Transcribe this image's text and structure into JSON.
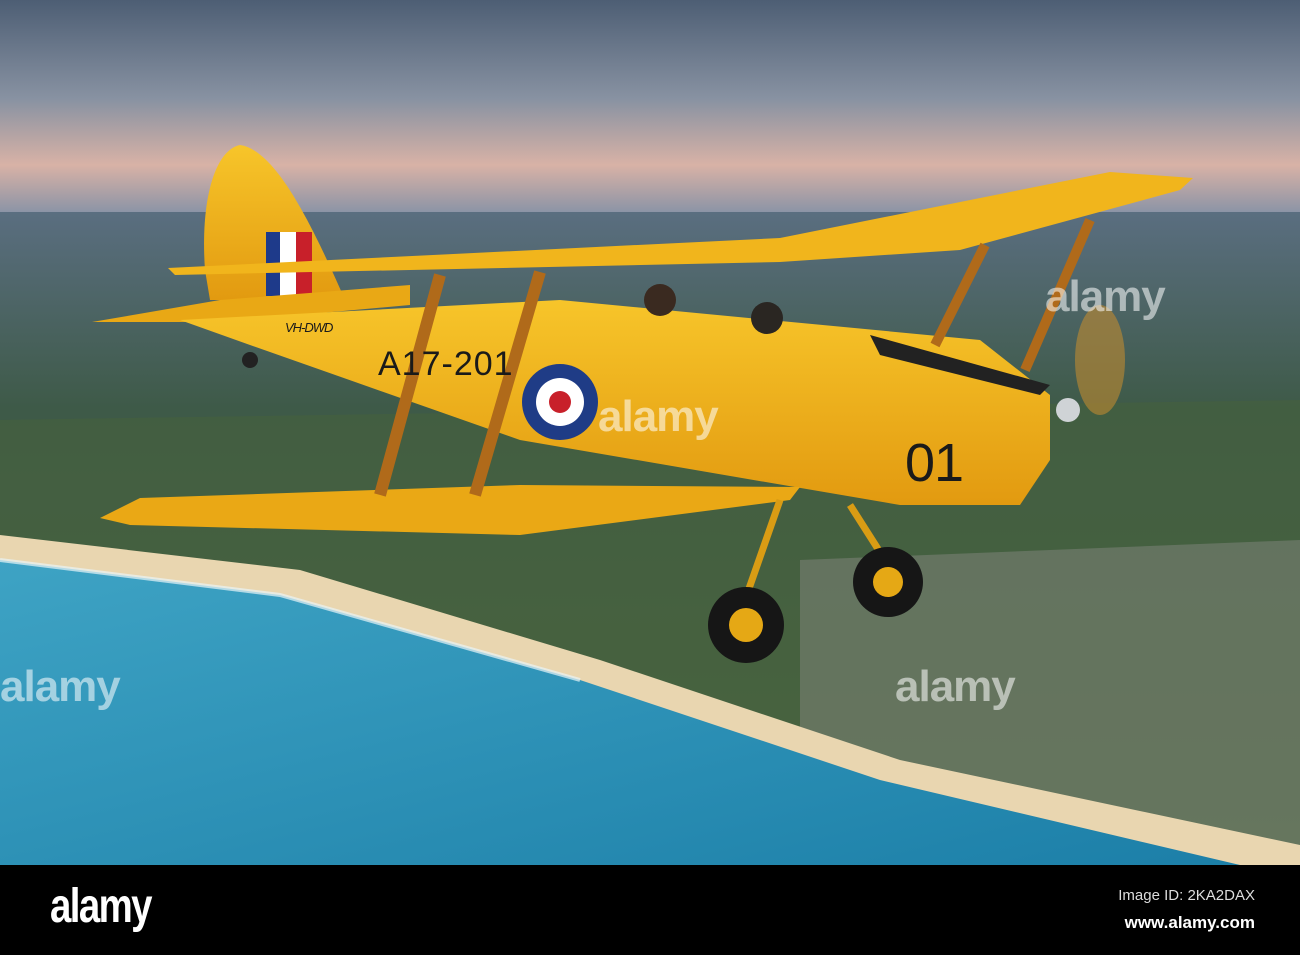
{
  "photo": {
    "subject": "Yellow biplane over coastline",
    "markings": {
      "serial": "A17-201",
      "registration": "VH-DWD",
      "code": "01"
    },
    "watermark": "alamy"
  },
  "footer": {
    "logo": "alamy",
    "image_id": "Image ID: 2KA2DAX",
    "url": "www.alamy.com"
  }
}
